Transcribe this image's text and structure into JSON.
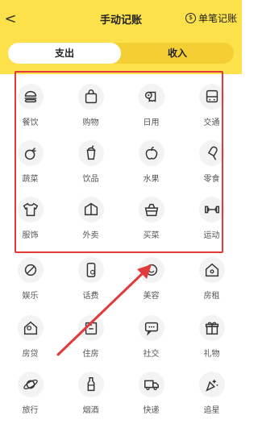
{
  "header": {
    "back": "<",
    "title": "手动记账",
    "single_icon": "$",
    "single": "单笔记账"
  },
  "tabs": {
    "expense": "支出",
    "income": "收入"
  },
  "colors": {
    "header": "#fce14b",
    "highlight": "#e23a3a"
  },
  "categories": [
    {
      "label": "餐饮",
      "icon": "burger-icon"
    },
    {
      "label": "购物",
      "icon": "shopping-bag-icon"
    },
    {
      "label": "日用",
      "icon": "tissue-roll-icon"
    },
    {
      "label": "交通",
      "icon": "bus-icon"
    },
    {
      "label": "蔬菜",
      "icon": "vegetable-icon"
    },
    {
      "label": "饮品",
      "icon": "drink-cup-icon"
    },
    {
      "label": "水果",
      "icon": "apple-icon"
    },
    {
      "label": "零食",
      "icon": "popsicle-icon"
    },
    {
      "label": "服饰",
      "icon": "tshirt-icon"
    },
    {
      "label": "外卖",
      "icon": "takeout-box-icon"
    },
    {
      "label": "买菜",
      "icon": "basket-icon"
    },
    {
      "label": "运动",
      "icon": "dumbbell-icon"
    },
    {
      "label": "娱乐",
      "icon": "entertainment-icon"
    },
    {
      "label": "话费",
      "icon": "phone-bill-icon"
    },
    {
      "label": "美容",
      "icon": "beauty-icon"
    },
    {
      "label": "房租",
      "icon": "house-rent-icon"
    },
    {
      "label": "房贷",
      "icon": "mortgage-icon"
    },
    {
      "label": "住房",
      "icon": "building-icon"
    },
    {
      "label": "社交",
      "icon": "chat-icon"
    },
    {
      "label": "礼物",
      "icon": "gift-icon"
    },
    {
      "label": "旅行",
      "icon": "planet-icon"
    },
    {
      "label": "烟酒",
      "icon": "bottle-icon"
    },
    {
      "label": "快递",
      "icon": "truck-icon"
    },
    {
      "label": "追星",
      "icon": "star-burst-icon"
    }
  ]
}
